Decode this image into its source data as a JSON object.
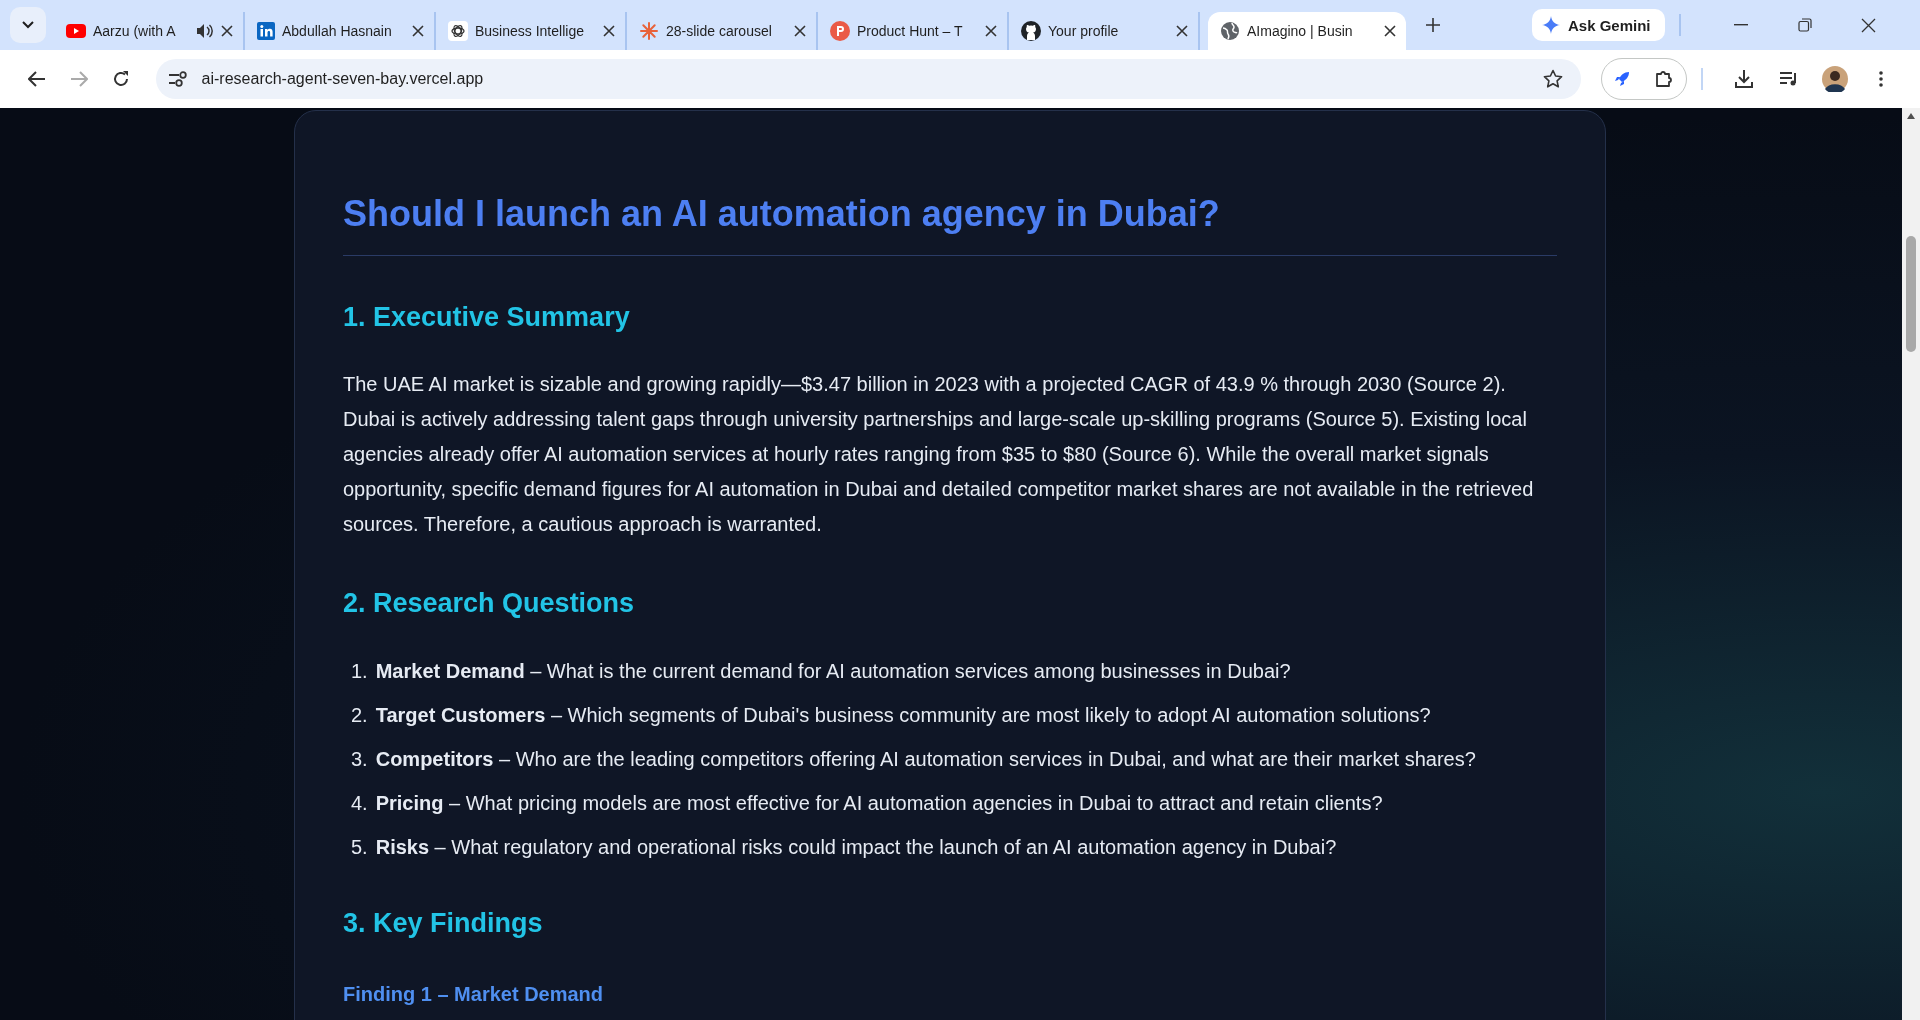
{
  "browser": {
    "tabs": [
      {
        "title": "Aarzu (with A",
        "selected": false,
        "audio": true
      },
      {
        "title": "Abdullah Hasnain",
        "selected": false,
        "audio": false
      },
      {
        "title": "Business Intellige",
        "selected": false,
        "audio": false
      },
      {
        "title": "28-slide carousel",
        "selected": false,
        "audio": false
      },
      {
        "title": "Product Hunt – T",
        "selected": false,
        "audio": false
      },
      {
        "title": "Your profile",
        "selected": false,
        "audio": false
      },
      {
        "title": "AImagino | Busin",
        "selected": true,
        "audio": false
      }
    ],
    "gemini": "Ask Gemini",
    "address": "ai-research-agent-seven-bay.vercel.app"
  },
  "report": {
    "title": "Should I launch an AI automation agency in Dubai?",
    "sections": [
      {
        "kind": "paragraph",
        "heading": "1. Executive Summary",
        "text": "The UAE AI market is sizable and growing rapidly—$3.47 billion in 2023 with a projected CAGR of 43.9 % through 2030 (Source 2). Dubai is actively addressing talent gaps through university partnerships and large-scale up-skilling programs (Source 5). Existing local agencies already offer AI automation services at hourly rates ranging from $35 to $80 (Source 6). While the overall market signals opportunity, specific demand figures for AI automation in Dubai and detailed competitor market shares are not available in the retrieved sources. Therefore, a cautious approach is warranted."
      },
      {
        "kind": "list",
        "heading": "2. Research Questions",
        "items": [
          {
            "number": "1.",
            "text": "**Market Demand** – What is the current demand for AI automation services among businesses in Dubai?"
          },
          {
            "number": "2.",
            "text": "**Target Customers** – Which segments of Dubai's business community are most likely to adopt AI automation solutions?"
          },
          {
            "number": "3.",
            "text": "**Competitors** – Who are the leading competitors offering AI automation services in Dubai, and what are their market shares?"
          },
          {
            "number": "4.",
            "text": "**Pricing** – What pricing models are most effective for AI automation agencies in Dubai to attract and retain clients?"
          },
          {
            "number": "5.",
            "text": "**Risks** – What regulatory and operational risks could impact the launch of an AI automation agency in Dubai?"
          }
        ]
      },
      {
        "kind": "findings",
        "heading": "3. Key Findings",
        "findings": [
          "Finding 1 – Market Demand"
        ]
      }
    ]
  }
}
